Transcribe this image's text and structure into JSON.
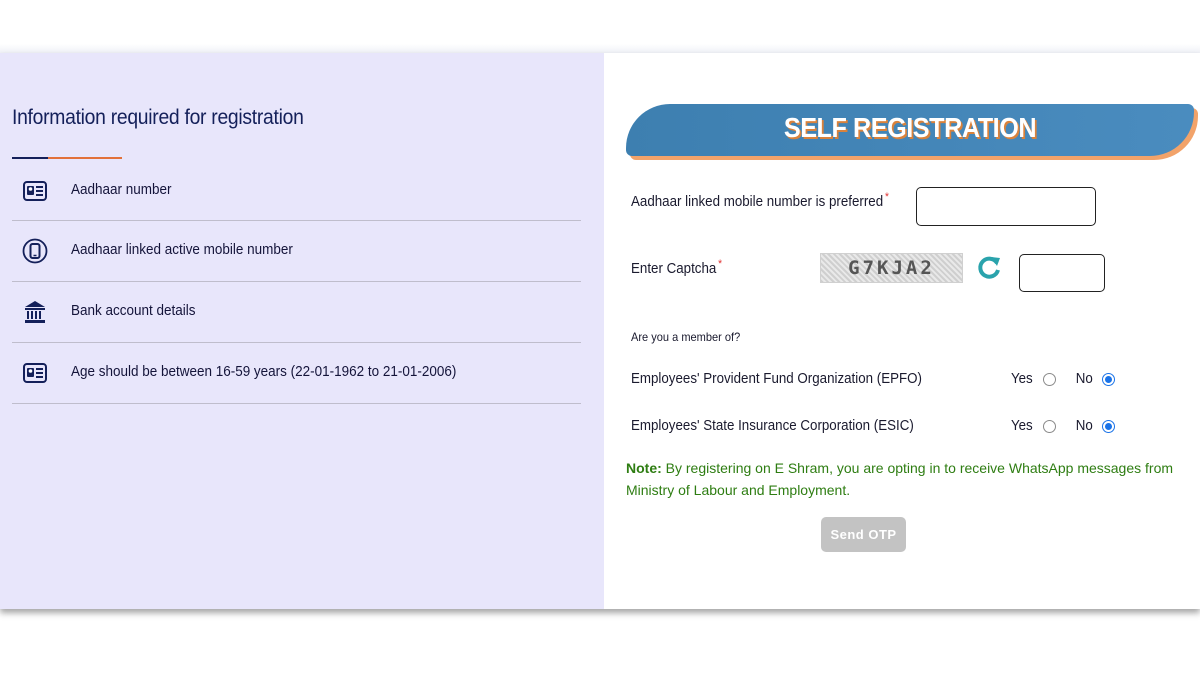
{
  "left_panel": {
    "title": "Information required for registration",
    "items": [
      {
        "icon": "id-card-icon",
        "label": "Aadhaar number"
      },
      {
        "icon": "mobile-phone-icon",
        "label": "Aadhaar linked active mobile number"
      },
      {
        "icon": "bank-icon",
        "label": "Bank account details"
      },
      {
        "icon": "id-card-icon",
        "label": "Age should be between 16-59 years (22-01-1962 to 21-01-2006)"
      }
    ]
  },
  "form": {
    "title": "SELF REGISTRATION",
    "mobile_label": "Aadhaar linked mobile number is preferred",
    "mobile_value": "",
    "captcha_label": "Enter Captcha",
    "captcha_text": "G7KJA2",
    "captcha_value": "",
    "required_mark": "*",
    "member_question": "Are you a member of?",
    "epfo_label": "Employees' Provident Fund Organization (EPFO)",
    "esic_label": "Employees' State Insurance Corporation (ESIC)",
    "yes_label": "Yes",
    "no_label": "No",
    "epfo_selected": "No",
    "esic_selected": "No",
    "note_prefix": "Note:",
    "note_text": " By registering on E Shram, you are opting in to receive WhatsApp messages from Ministry of Labour and Employment.",
    "send_otp_label": "Send OTP"
  },
  "colors": {
    "left_bg": "#e8e6fb",
    "banner_blue": "#3d7fb0",
    "banner_shadow": "#f2a36a",
    "note_green": "#2e7d12",
    "required_red": "#e03030",
    "radio_blue": "#1a73e8",
    "button_gray": "#c3c3c3"
  }
}
